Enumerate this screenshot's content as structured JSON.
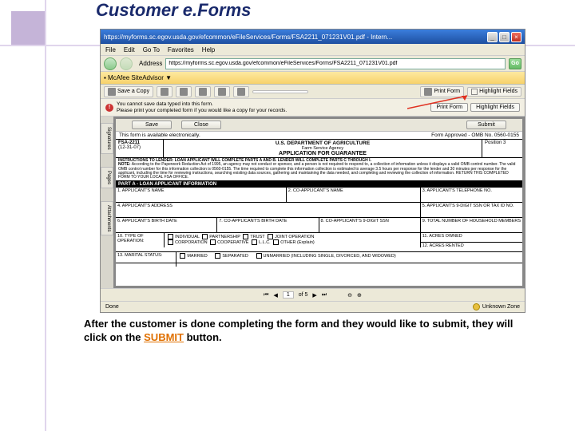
{
  "slide": {
    "title": "Customer e.Forms",
    "caption_part1": "After the customer is done completing the form and they would like to submit, they will click on the ",
    "caption_highlight": "SUBMIT",
    "caption_part2": " button."
  },
  "browser": {
    "title_bar": "https://myforms.sc.egov.usda.gov/efcommon/eFileServices/Forms/FSA2211_071231V01.pdf - Intern...",
    "window_min": "_",
    "window_max": "□",
    "window_close": "×",
    "menu": {
      "file": "File",
      "edit": "Edit",
      "goto": "Go To",
      "favorites": "Favorites",
      "help": "Help"
    },
    "address_label": "Address",
    "address_value": "https://myforms.sc.egov.usda.gov/efcommon/eFileServices/Forms/FSA2211_071231V01.pdf",
    "go_label": "Go",
    "adobe_bar": "▪ McAfee SiteAdvisor ▼",
    "tb": {
      "save_copy": "Save a Copy",
      "print": "Print",
      "search": "Search",
      "print_form": "Print Form",
      "highlight": "Highlight Fields"
    },
    "warning": {
      "line1": "You cannot save data typed into this form.",
      "line2": "Please print your completed form if you would like a copy for your records."
    },
    "actions": {
      "save": "Save",
      "close": "Close",
      "submit": "Submit"
    },
    "side_tabs": {
      "pages": "Pages",
      "signatures": "Signatures",
      "attachments": "Attachments"
    },
    "pdf_nav": {
      "page": "1",
      "of": "of 5"
    },
    "status": {
      "done": "Done",
      "zone": "Unknown Zone"
    }
  },
  "form": {
    "avail_text": "This form is available electronically.",
    "omb": "Form Approved - OMB No. 0560-0155",
    "form_no": "FSA-2211",
    "form_date": "(12-31-07)",
    "dept": "U.S. DEPARTMENT OF AGRICULTURE",
    "agency": "Farm Service Agency",
    "app_title": "APPLICATION FOR GUARANTEE",
    "position": "Position 3",
    "instructions_head": "INSTRUCTIONS TO LENDER:  LOAN APPLICANT WILL COMPLETE PARTS A AND B.  LENDER WILL COMPLETE PARTS C THROUGH I.",
    "note_label": "NOTE:",
    "note_text": "According to the Paperwork Reduction Act of 1995, an agency may not conduct or sponsor, and a person is not required to respond to, a collection of information unless it displays a valid OMB control number. The valid OMB control number for this information collection is 0560-0155. The time required to complete this information collection is estimated to average 3.5 hours per response for the lender and 30 minutes per response for the applicant, including the time for reviewing instructions, searching existing data sources, gathering and maintaining the data needed, and completing and reviewing the collection of information. RETURN THIS COMPLETED FORM TO YOUR LOCAL FSA OFFICE.",
    "part_a": "PART A - LOAN APPLICANT INFORMATION",
    "fields": {
      "f1": "1. APPLICANT'S NAME",
      "f2": "2. CO-APPLICANT'S NAME",
      "f3": "3. APPLICANT'S TELEPHONE NO.",
      "f4": "4. APPLICANT'S ADDRESS",
      "f5": "5. APPLICANT'S 9-DIGIT SSN OR TAX ID NO.",
      "f6": "6. APPLICANT'S BIRTH DATE",
      "f7": "7. CO-APPLICANT'S BIRTH DATE",
      "f8": "8. CO-APPLICANT'S 9-DIGIT SSN",
      "f9": "9. TOTAL NUMBER OF HOUSEHOLD MEMBERS",
      "f10": "10. TYPE OF OPERATION:",
      "opt_individual": "INDIVIDUAL",
      "opt_partnership": "PARTNERSHIP",
      "opt_trust": "TRUST",
      "opt_joint": "JOINT OPERATION",
      "opt_corp": "CORPORATION",
      "opt_coop": "COOPERATIVE",
      "opt_llc": "L.L.C.",
      "opt_other": "OTHER (Explain)",
      "f11": "11. ACRES OWNED",
      "f12": "12. ACRES RENTED",
      "f13": "13. MARITAL STATUS:",
      "opt_married": "MARRIED",
      "opt_separated": "SEPARATED",
      "opt_unmarried": "UNMARRIED (INCLUDING SINGLE, DIVORCED, AND WIDOWED)"
    }
  }
}
